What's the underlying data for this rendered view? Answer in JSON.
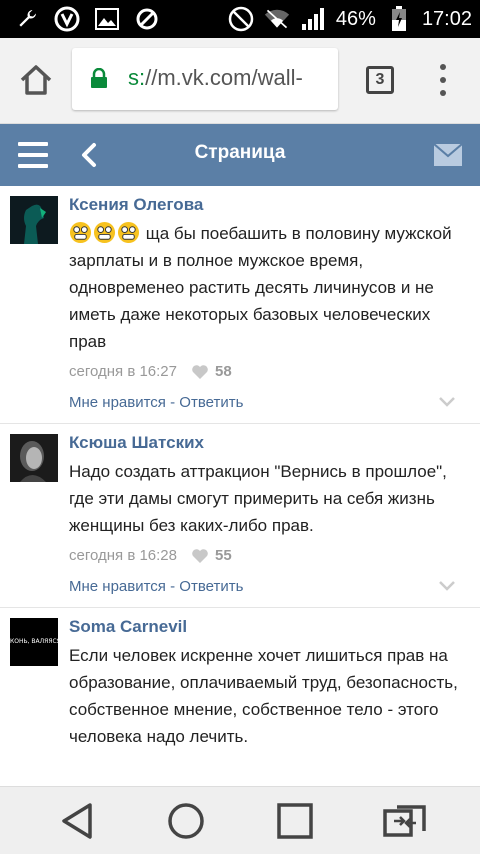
{
  "status": {
    "battery": "46%",
    "time": "17:02",
    "icons": [
      "wrench-icon",
      "vk-app-icon",
      "image-icon",
      "blocked-icon",
      "mute-icon",
      "wifi-icon",
      "signal-icon",
      "battery-icon"
    ]
  },
  "browser": {
    "url_scheme": "s:",
    "url_rest": "//m.vk.com/wall-",
    "tab_count": "3"
  },
  "header": {
    "title": "Страница"
  },
  "comments": [
    {
      "author": "Ксения Олегова",
      "emoji_count": 3,
      "text": "ща бы поебашить в половину мужской зарплаты и в полное мужское время, одновременео растить десять личинусов и не иметь даже некоторых базовых человеческих прав",
      "time": "сегодня в 16:27",
      "likes": "58",
      "like_label": "Мне нравится",
      "separator": " - ",
      "reply_label": "Ответить"
    },
    {
      "author": "Ксюша Шатских",
      "text": "Надо создать аттракцион \"Вернись в прошлое\", где эти дамы смогут примерить на себя жизнь женщины без каких-либо прав.",
      "time": "сегодня в 16:28",
      "likes": "55",
      "like_label": "Мне нравится",
      "separator": " - ",
      "reply_label": "Ответить"
    },
    {
      "author": "Soma Carnevil",
      "avatar_text": "КОНЬ, ВАЛЯЯСЯ",
      "text": "Если человек искренне хочет лишиться прав на образование, оплачиваемый труд, безопасность, собственное мнение, собственное тело - этого человека надо лечить."
    }
  ],
  "colors": {
    "header_bg": "#5b7fa6",
    "link": "#476a95",
    "url_scheme": "#0a8a3a"
  }
}
